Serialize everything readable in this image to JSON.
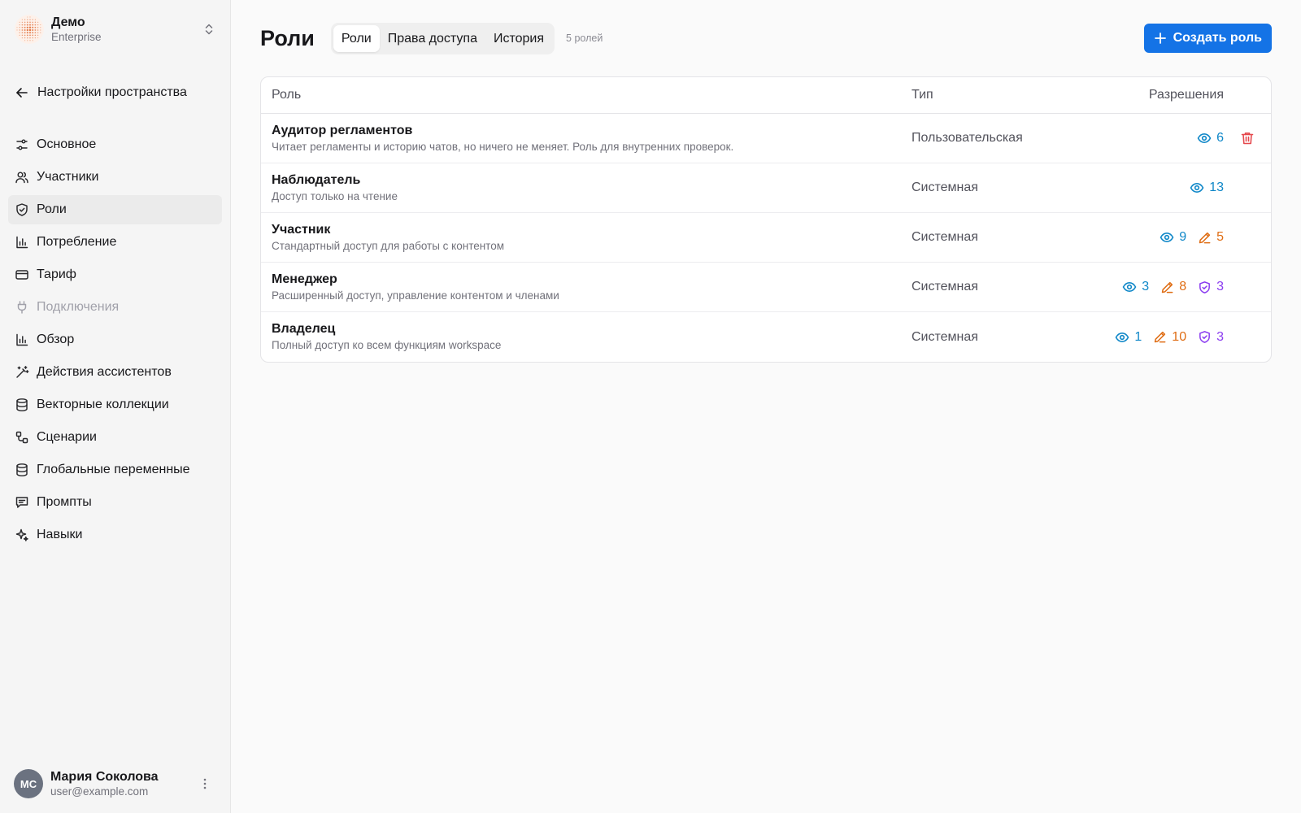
{
  "workspace": {
    "name": "Демо",
    "plan": "Enterprise"
  },
  "back": {
    "label": "Настройки пространства"
  },
  "nav": [
    {
      "id": "basic",
      "label": "Основное",
      "icon": "sliders-icon"
    },
    {
      "id": "members",
      "label": "Участники",
      "icon": "users-icon"
    },
    {
      "id": "roles",
      "label": "Роли",
      "icon": "shield-icon",
      "active": true
    },
    {
      "id": "usage",
      "label": "Потребление",
      "icon": "bar-chart-icon"
    },
    {
      "id": "plan",
      "label": "Тариф",
      "icon": "credit-card-icon"
    },
    {
      "id": "connections",
      "label": "Подключения",
      "icon": "plug-icon",
      "disabled": true
    },
    {
      "id": "overview",
      "label": "Обзор",
      "icon": "bar-chart-icon"
    },
    {
      "id": "assistant-actions",
      "label": "Действия ассистентов",
      "icon": "magic-wand-icon"
    },
    {
      "id": "vector-collections",
      "label": "Векторные коллекции",
      "icon": "database-icon"
    },
    {
      "id": "scenarios",
      "label": "Сценарии",
      "icon": "workflow-icon"
    },
    {
      "id": "global-vars",
      "label": "Глобальные переменные",
      "icon": "database-icon"
    },
    {
      "id": "prompts",
      "label": "Промпты",
      "icon": "message-icon"
    },
    {
      "id": "skills",
      "label": "Навыки",
      "icon": "sparkles-icon"
    }
  ],
  "user": {
    "initials": "МС",
    "name": "Мария Соколова",
    "email": "user@example.com"
  },
  "page": {
    "title": "Роли",
    "tabs": [
      "Роли",
      "Права доступа",
      "История"
    ],
    "count": "5 ролей",
    "create_label": "Создать роль"
  },
  "table": {
    "headers": {
      "role": "Роль",
      "type": "Тип",
      "permissions": "Разрешения"
    },
    "rows": [
      {
        "name": "Аудитор регламентов",
        "desc": "Читает регламенты и историю чатов, но ничего не меняет. Роль для внутренних проверок.",
        "type": "Пользовательская",
        "view": "6",
        "edit": null,
        "admin": null,
        "deletable": true
      },
      {
        "name": "Наблюдатель",
        "desc": "Доступ только на чтение",
        "type": "Системная",
        "view": "13",
        "edit": null,
        "admin": null,
        "deletable": false
      },
      {
        "name": "Участник",
        "desc": "Стандартный доступ для работы с контентом",
        "type": "Системная",
        "view": "9",
        "edit": "5",
        "admin": null,
        "deletable": false
      },
      {
        "name": "Менеджер",
        "desc": "Расширенный доступ, управление контентом и членами",
        "type": "Системная",
        "view": "3",
        "edit": "8",
        "admin": "3",
        "deletable": false
      },
      {
        "name": "Владелец",
        "desc": "Полный доступ ко всем функциям workspace",
        "type": "Системная",
        "view": "1",
        "edit": "10",
        "admin": "3",
        "deletable": false
      }
    ]
  },
  "colors": {
    "accent": "#1473e6",
    "view": "#0f87c8",
    "edit": "#df6d14",
    "admin": "#8b3cf0",
    "danger": "#e5484d"
  }
}
